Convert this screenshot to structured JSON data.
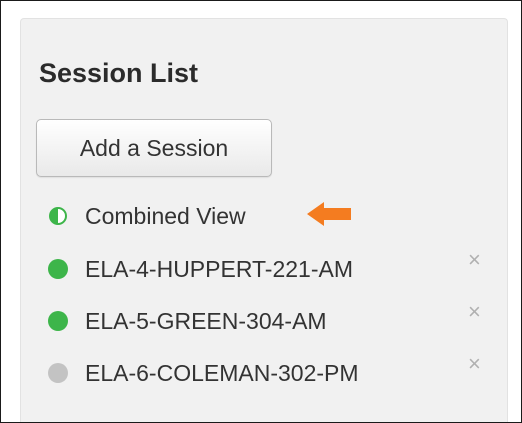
{
  "panel": {
    "title": "Session List",
    "add_button_label": "Add a Session"
  },
  "sessions": [
    {
      "label": "Combined View",
      "status": "combined",
      "status_color": "#3db54a",
      "removable": false
    },
    {
      "label": "ELA-4-HUPPERT-221-AM",
      "status": "active",
      "status_color": "#3db54a",
      "removable": true
    },
    {
      "label": "ELA-5-GREEN-304-AM",
      "status": "active",
      "status_color": "#3db54a",
      "removable": true
    },
    {
      "label": "ELA-6-COLEMAN-302-PM",
      "status": "inactive",
      "status_color": "#c3c3c3",
      "removable": true
    }
  ],
  "remove_icon": "×",
  "annotation": {
    "icon": "arrow-left-icon",
    "color": "#f47c20"
  }
}
